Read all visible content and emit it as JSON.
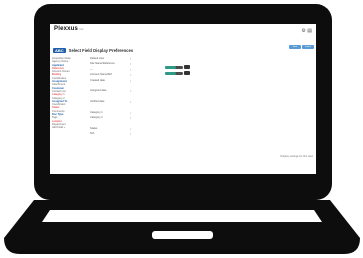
{
  "app": {
    "logo": "Plexxus",
    "logo_sub": "inc",
    "top_icons": "⚙ ▤",
    "page_badge": "ABC",
    "page_title": "Select Field Display Preferences"
  },
  "toolbar": {
    "buttons": [
      "Save",
      "Cancel"
    ]
  },
  "sidebar": {
    "items": [
      {
        "label": "Acquisition Date",
        "style": "gray"
      },
      {
        "label": "Agency Name",
        "style": "gray"
      },
      {
        "label": "Applicant",
        "style": "head"
      },
      {
        "label": "Reference",
        "style": "red"
      },
      {
        "label": "Account Owner",
        "style": "gray"
      },
      {
        "label": "Building",
        "style": "red"
      },
      {
        "label": "Coordinates",
        "style": "gray"
      },
      {
        "label": "Assignment",
        "style": "head"
      },
      {
        "label": "Attachment",
        "style": "gray"
      },
      {
        "label": "Customer",
        "style": "head"
      },
      {
        "label": "Contact List",
        "style": "gray"
      },
      {
        "label": "Category 1",
        "style": "red"
      },
      {
        "label": "Category 2",
        "style": "gray"
      },
      {
        "label": "Assigned To",
        "style": "head"
      },
      {
        "label": "Coordinator",
        "style": "gray"
      },
      {
        "label": "Status",
        "style": "red"
      },
      {
        "label": "Comments",
        "style": "gray"
      },
      {
        "label": "Doc Type",
        "style": "head"
      },
      {
        "label": "Tags",
        "style": "gray"
      },
      {
        "label": "Location",
        "style": "red"
      },
      {
        "label": "Department",
        "style": "gray"
      },
      {
        "label": "Add Field +",
        "style": "gray"
      }
    ]
  },
  "main": {
    "rows": [
      {
        "label": "Default view"
      },
      {
        "label": "Site Name/Reference"
      },
      {
        "label": "—"
      },
      {
        "label": "Account Name/Ref"
      },
      {
        "label": "Created date"
      },
      {
        "label": ""
      },
      {
        "label": "Assigned date"
      },
      {
        "label": ""
      },
      {
        "label": "Verified date"
      },
      {
        "label": ""
      },
      {
        "label": "Category 1"
      },
      {
        "label": "Category 2"
      },
      {
        "label": ""
      },
      {
        "label": "Status"
      },
      {
        "label": "N/A"
      }
    ],
    "select_glyph": "↕"
  },
  "toggles": [
    {
      "name": "toggle-1",
      "level": 0.6
    },
    {
      "name": "toggle-2",
      "level": 0.6
    }
  ],
  "right_link": "Display settings for this view",
  "colors": {
    "accent": "#1f5fa8",
    "toggle_on": "#2f9a86",
    "laptop": "#0d0d0d"
  }
}
